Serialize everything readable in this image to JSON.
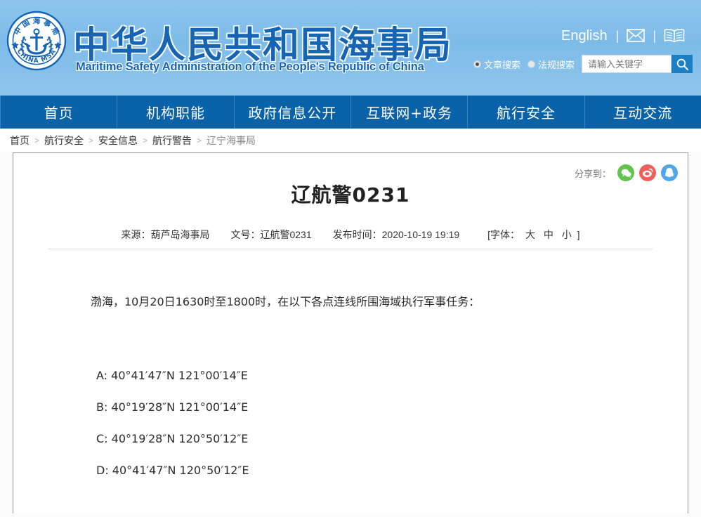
{
  "header": {
    "brand_cn": "中华人民共和国海事局",
    "brand_en": "Maritime Safety Administration of the People's Republic of China",
    "logo_alt": "china-msa-emblem",
    "logo_text_cn": "中国海事局",
    "logo_text_en": "CHINA MSA",
    "english_link": "English",
    "separator": "|",
    "mail_icon": "envelope-icon",
    "book_icon": "open-book-icon",
    "search": {
      "options": [
        {
          "label": "文章搜索",
          "selected": true
        },
        {
          "label": "法规搜索",
          "selected": false
        }
      ],
      "placeholder": "请输入关键字",
      "value": "",
      "button_icon": "search-icon"
    },
    "bg_color": "#7dbbe8",
    "brand_color": "#1565b4"
  },
  "nav": {
    "items": [
      {
        "label": "首页"
      },
      {
        "label": "机构职能"
      },
      {
        "label": "政府信息公开"
      },
      {
        "label": "互联网+政务"
      },
      {
        "label": "航行安全"
      },
      {
        "label": "互动交流"
      }
    ],
    "bg_color": "#0a62a8"
  },
  "breadcrumb": {
    "separator": ">",
    "items": [
      {
        "label": "首页"
      },
      {
        "label": "航行安全"
      },
      {
        "label": "安全信息"
      },
      {
        "label": "航行警告"
      },
      {
        "label": "辽宁海事局"
      }
    ]
  },
  "article": {
    "title": "辽航警0231",
    "share_label": "分享到：",
    "share_icons": [
      {
        "name": "wechat-share-icon",
        "color": "#5fc44a"
      },
      {
        "name": "weibo-share-icon",
        "color": "#f0605a"
      },
      {
        "name": "qq-share-icon",
        "color": "#4fa6e8"
      }
    ],
    "meta": {
      "source": "来源：葫芦岛海事局",
      "doc_no": "文号：辽航警0231",
      "publish_time": "发布时间：2020-10-19 19:19",
      "font_prefix": "[字体：",
      "font_large": "大",
      "font_medium": "中",
      "font_small": "小",
      "font_suffix": "]"
    },
    "body": "渤海，10月20日1630时至1800时，在以下各点连线所围海域执行军事任务：",
    "coordinates": [
      "A: 40°41′47″N 121°00′14″E",
      "B: 40°19′28″N 121°00′14″E",
      "C: 40°19′28″N 120°50′12″E",
      "D: 40°41′47″N 120°50′12″E"
    ]
  }
}
